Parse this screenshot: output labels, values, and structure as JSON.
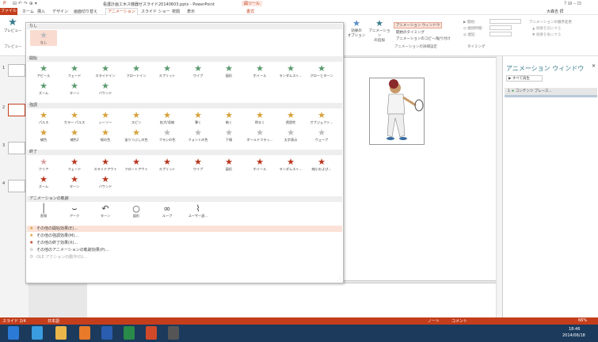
{
  "window": {
    "title": "看護計画エ木ス機器ゼスライド20140603.pptx - PowerPoint",
    "tool_tab": "図ツール",
    "user": "大森吉 拝",
    "controls": "? ⊟ – ⊡"
  },
  "tabs": [
    "ファイル",
    "ホーム",
    "挿入",
    "デザイン",
    "画面切り替え",
    "アニメーション",
    "スライド ショー",
    "校閲",
    "表示",
    "書式"
  ],
  "ribbon": {
    "preview": "プレビュー",
    "preview_group": "プレビュー",
    "effect_options": "効果の\nオプション",
    "add_animation": "アニメーション\nの追加",
    "anim_pane": "アニメーション ウィンドウ",
    "trigger": "開始のタイミング",
    "painter": "アニメーションのコピー/貼り付け",
    "advanced_group": "アニメーションの詳細設定",
    "start_label": "▶ 開始:",
    "duration_label": "◷ 継続時間:",
    "delay_label": "◎ 遅延:",
    "reorder_title": "アニメーションの順序変更",
    "move_earlier": "▲ 順番を前にする",
    "move_later": "▼ 順番を後にする",
    "timing_group": "タイミング"
  },
  "dropdown": {
    "none_header": "なし",
    "none_item": "なし",
    "sections": {
      "entrance": "開始",
      "emphasis": "強調",
      "exit": "終了",
      "path": "アニメーションの軌跡"
    },
    "entrance": [
      "アピール",
      "フェード",
      "スライドイン",
      "フロートイン",
      "スプリット",
      "ワイプ",
      "図形",
      "ホイール",
      "ランダムスト...",
      "グローとターン",
      "ズーム",
      "ターン",
      "バウンド"
    ],
    "emphasis": [
      "パルス",
      "カラー パルス",
      "シーソー",
      "スピン",
      "拡大/収縮",
      "薄く",
      "暗く",
      "明るく",
      "透過性",
      "オブジェクト...",
      "補色",
      "補色2",
      "線の色",
      "塗りつぶしの色",
      "ブラシの色",
      "フォントの色",
      "下線",
      "ボールドフラッ...",
      "太字表示",
      "ウェーブ"
    ],
    "exit": [
      "クリア",
      "フェード",
      "スライドアウト",
      "フロートアウト",
      "スプリット",
      "ワイプ",
      "図形",
      "ホイール",
      "ランダムスト...",
      "縮小および...",
      "ズーム",
      "ターン",
      "バウンド"
    ],
    "paths": [
      "直線",
      "アーク",
      "ターン",
      "図形",
      "ループ",
      "ユーザー設..."
    ],
    "more": [
      "その他の開始効果(E)...",
      "その他の強調効果(M)...",
      "その他の終了効果(X)...",
      "その他のアニメーションの軌跡効果(P)...",
      "OLE アクションの動作(O)..."
    ]
  },
  "slides": {
    "numbers": [
      "1",
      "2",
      "3",
      "4"
    ]
  },
  "anim_pane": {
    "title": "アニメーション ウィンドウ",
    "play_all": "▶ すべて再生",
    "item_num": "1",
    "item_label": "コンテンツ プレース..."
  },
  "status": {
    "slide_info": "スライド 2/4",
    "language": "日本語",
    "notes": "ノート",
    "comments": "コメント",
    "zoom": "66%"
  },
  "taskbar": {
    "time": "18:46",
    "date": "2014/06/18"
  },
  "notes_pane": {
    "page": "1 2"
  }
}
